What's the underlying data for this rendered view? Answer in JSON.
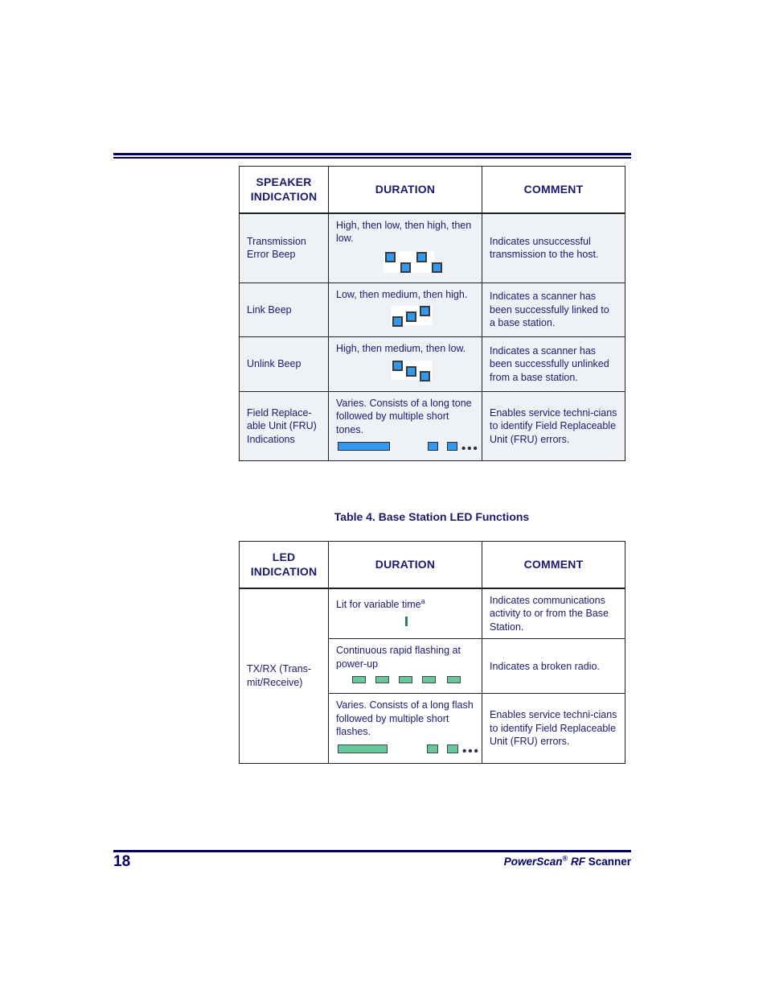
{
  "page": {
    "number": "18",
    "footer_product": "PowerScan",
    "footer_registered": "®",
    "footer_rf": "RF",
    "footer_scanner": "Scanner"
  },
  "colors": {
    "navy_text": "#1a1a6e",
    "navy_rule": "#000066",
    "shade_cell": "#eef2f7",
    "beep_blue": "#3399ee",
    "led_green": "#68c79b",
    "border": "#202020"
  },
  "speaker_table": {
    "headers": {
      "col1_line1": "SPEAKER",
      "col1_line2": "INDICATION",
      "col2": "DURATION",
      "col3": "COMMENT"
    },
    "rows": [
      {
        "indication": "Transmission\nError Beep",
        "duration": "High, then low, then high, then low.",
        "comment": "Indicates unsuccessful transmission to the host.",
        "diagram": "four-square-high-low-high-low"
      },
      {
        "indication": "Link Beep",
        "duration": "Low, then medium, then high.",
        "comment": "Indicates a scanner has been successfully linked to a base station.",
        "diagram": "three-square-ascending"
      },
      {
        "indication": "Unlink Beep",
        "duration": "High, then medium, then low.",
        "comment": "Indicates a scanner has been successfully unlinked from a base station.",
        "diagram": "three-square-descending"
      },
      {
        "indication": " Field Replace-\nable Unit (FRU)\nIndications",
        "duration": "Varies. Consists of a long tone followed by multiple short tones.",
        "comment": "Enables service techni-cians to identify Field Replaceable Unit (FRU) errors.",
        "diagram": "long-bar-then-short-bars-ellipsis"
      }
    ]
  },
  "caption": {
    "label": "Table 4",
    "separator": ". ",
    "title": "Base Station LED Functions"
  },
  "led_table": {
    "headers": {
      "col1_line1": "LED",
      "col1_line2": "INDICATION",
      "col2": "DURATION",
      "col3": "COMMENT"
    },
    "row_label": "TX/RX (Trans-\nmit/Receive)",
    "rows": [
      {
        "duration": "Lit for variable time",
        "duration_superscript": "a",
        "comment": "Indicates communications activity to or from the Base Station.",
        "diagram": "single-green-tick"
      },
      {
        "duration": "Continuous rapid flashing at power-up",
        "duration_superscript": "",
        "comment": "Indicates a broken radio.",
        "diagram": "five-green-rects"
      },
      {
        "duration": "Varies. Consists of a long flash followed by multiple short flashes.",
        "duration_superscript": "",
        "comment": "Enables service techni-cians to identify Field Replaceable Unit (FRU) errors.",
        "diagram": "long-green-bar-then-short-ellipsis"
      }
    ]
  }
}
